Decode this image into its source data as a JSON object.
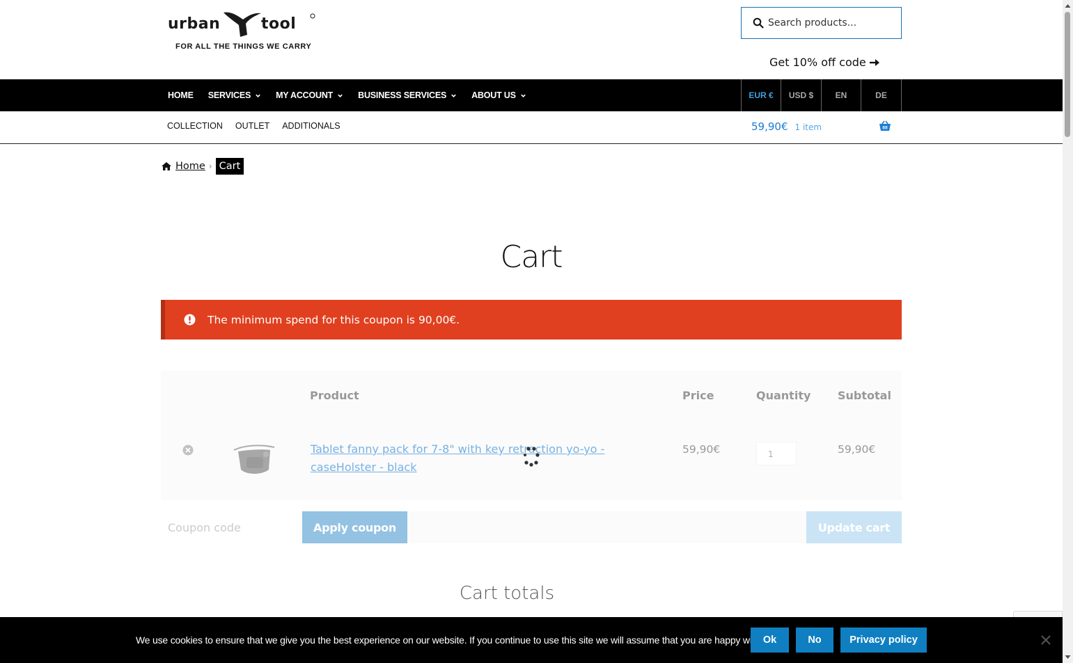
{
  "header": {
    "logo_text": "urbantool",
    "tagline": "FOR ALL THE THINGS WE CARRY",
    "search_placeholder": "Search products...",
    "promo_text": "Get 10% off code"
  },
  "main_nav": {
    "items": [
      {
        "label": "HOME",
        "has_dropdown": false
      },
      {
        "label": "SERVICES",
        "has_dropdown": true
      },
      {
        "label": "MY ACCOUNT",
        "has_dropdown": true
      },
      {
        "label": "BUSINESS SERVICES",
        "has_dropdown": true
      },
      {
        "label": "ABOUT US",
        "has_dropdown": true
      }
    ],
    "switchers": [
      {
        "label": "EUR €",
        "active": true
      },
      {
        "label": "USD $",
        "active": false
      },
      {
        "label": "EN",
        "active": false
      },
      {
        "label": "DE",
        "active": false
      }
    ]
  },
  "sub_nav": {
    "items": [
      "COLLECTION",
      "OUTLET",
      "ADDITIONALS"
    ]
  },
  "mini_cart": {
    "amount": "59,90€",
    "count": "1 item"
  },
  "breadcrumb": {
    "home": "Home",
    "current": "Cart"
  },
  "page": {
    "title": "Cart",
    "error_message": "The minimum spend for this coupon is 90,00€."
  },
  "cart_table": {
    "headers": {
      "product": "Product",
      "price": "Price",
      "quantity": "Quantity",
      "subtotal": "Subtotal"
    },
    "rows": [
      {
        "product": "Tablet fanny pack for 7-8\" with key retraction yo-yo - caseHolster - black",
        "price": "59,90€",
        "quantity": "1",
        "subtotal": "59,90€"
      }
    ]
  },
  "actions": {
    "coupon_placeholder": "Coupon code",
    "apply_label": "Apply coupon",
    "update_label": "Update cart"
  },
  "cart_totals": {
    "title": "Cart totals"
  },
  "cookie_bar": {
    "message": "We use cookies to ensure that we give you the best experience on our website. If you continue to use this site we will assume that you are happy with it.",
    "ok_label": "Ok",
    "no_label": "No",
    "privacy_label": "Privacy policy"
  },
  "colors": {
    "accent": "#1b7ed1",
    "error": "#e0401f",
    "nav_bg": "#000000",
    "cookie_button": "#0f7fc2"
  }
}
